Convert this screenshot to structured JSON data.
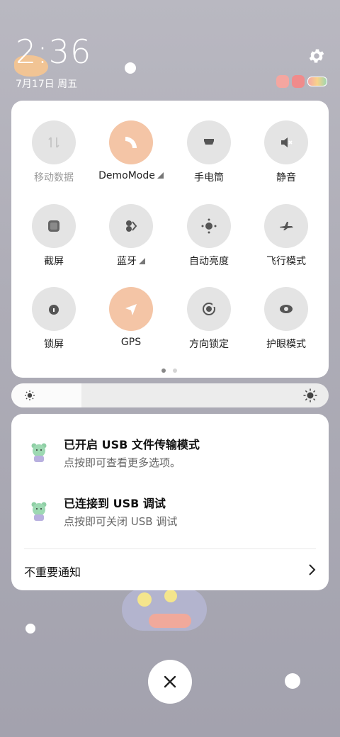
{
  "status": {
    "time": "2:36",
    "date": "7月17日 周五",
    "icons": [
      "settings-gear-icon",
      "notification-app-icon",
      "notification-app-icon-2",
      "battery-icon"
    ]
  },
  "quick_settings": {
    "tiles": [
      {
        "label": "移动数据",
        "icon": "mobile-data-icon",
        "active": false,
        "disabled": true
      },
      {
        "label": "DemoMode",
        "icon": "demo-mode-icon",
        "active": true,
        "has_menu": true
      },
      {
        "label": "手电筒",
        "icon": "flashlight-icon",
        "active": false
      },
      {
        "label": "静音",
        "icon": "mute-icon",
        "active": false
      },
      {
        "label": "截屏",
        "icon": "screenshot-icon",
        "active": false
      },
      {
        "label": "蓝牙",
        "icon": "bluetooth-icon",
        "active": false,
        "has_menu": true
      },
      {
        "label": "自动亮度",
        "icon": "auto-brightness-icon",
        "active": false
      },
      {
        "label": "飞行模式",
        "icon": "airplane-icon",
        "active": false
      },
      {
        "label": "锁屏",
        "icon": "lock-icon",
        "active": false
      },
      {
        "label": "GPS",
        "icon": "gps-icon",
        "active": true
      },
      {
        "label": "方向锁定",
        "icon": "rotation-lock-icon",
        "active": false
      },
      {
        "label": "护眼模式",
        "icon": "eye-icon",
        "active": false
      }
    ],
    "page_count": 2,
    "current_page": 1
  },
  "brightness": {
    "level": 0.22
  },
  "notifications": [
    {
      "title": "已开启 USB 文件传输模式",
      "subtitle": "点按即可查看更多选项。",
      "icon": "app-mascot-icon"
    },
    {
      "title": "已连接到 USB 调试",
      "subtitle": "点按即可关闭 USB 调试",
      "icon": "app-mascot-icon"
    }
  ],
  "unimportant_label": "不重要通知",
  "colors": {
    "active_tile": "#f4c5a6",
    "inactive_tile": "#e4e4e4",
    "panel": "#ffffff"
  }
}
